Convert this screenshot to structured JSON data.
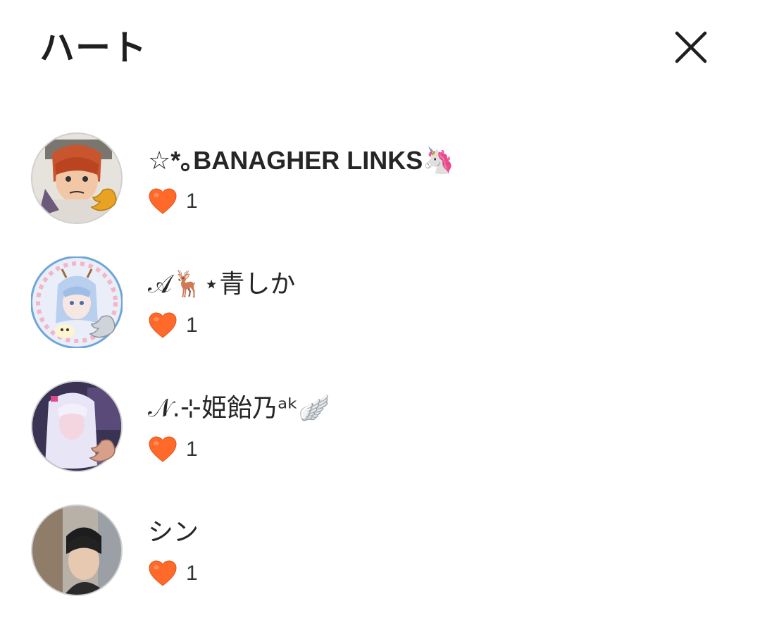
{
  "header": {
    "title": "ハート",
    "close_icon": "close-icon"
  },
  "colors": {
    "heart": "#ff6a2b",
    "text": "#262626"
  },
  "users": [
    {
      "name": "☆*｡BANAGHER LINKS🦄",
      "hearts": "1",
      "avatar": "drawing-red-hair",
      "badge": "gold"
    },
    {
      "name": "𝒜🦌⋆青しか",
      "hearts": "1",
      "avatar": "anime-blue-hair",
      "badge": "silver"
    },
    {
      "name": "𝒩.⊹姫飴乃ᵃᵏ🪽",
      "hearts": "1",
      "avatar": "photo-white-hair",
      "badge": "bronze"
    },
    {
      "name": "シン",
      "hearts": "1",
      "avatar": "photo-dark-hair",
      "badge": "none"
    }
  ]
}
